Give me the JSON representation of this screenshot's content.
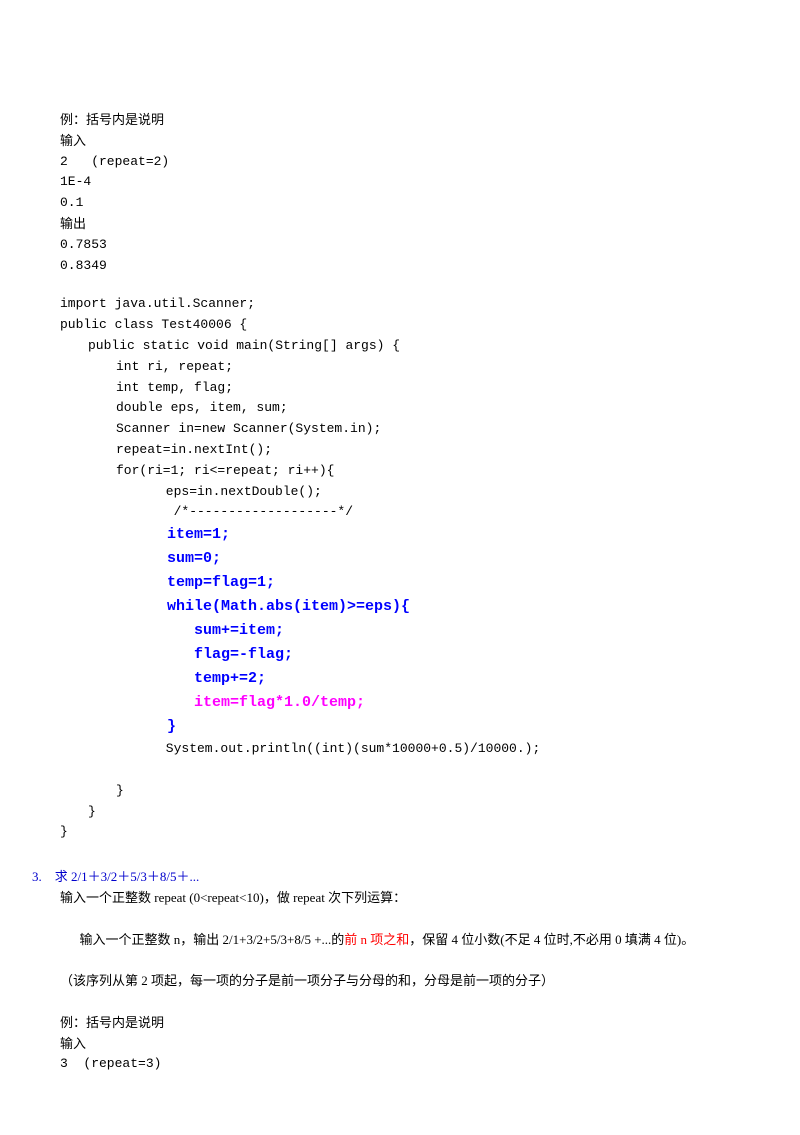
{
  "intro": {
    "l1": "例：括号内是说明",
    "l2": "输入",
    "l3": "2   (repeat=2)",
    "l4": "1E-4",
    "l5": "0.1",
    "l6": "输出",
    "l7": "0.7853",
    "l8": "0.8349"
  },
  "code1": {
    "l1": "import java.util.Scanner;",
    "l2": "public class Test40006 {",
    "l3": "public static void main(String[] args) {",
    "l4": "int ri, repeat;",
    "l5": "int temp, flag;",
    "l6": "double eps, item, sum;",
    "l7": "Scanner in=new Scanner(System.in);",
    "l8": "repeat=in.nextInt();",
    "l9": "for(ri=1; ri<=repeat; ri++){",
    "l10": " eps=in.nextDouble();",
    "l11": "  /*-------------------*/",
    "l12": " item=1;",
    "l13": " sum=0;",
    "l14": " temp=flag=1;",
    "l15": " while(Math.abs(item)>=eps){",
    "l16": "    sum+=item;",
    "l17": "    flag=-flag;",
    "l18": "    temp+=2;",
    "l19": "    item=flag*1.0/temp;",
    "l20": " }",
    "l21": " System.out.println((int)(sum*10000+0.5)/10000.);",
    "l22": "}",
    "l23": "}",
    "l24": "}"
  },
  "section": {
    "num": "3.",
    "title": "求 2/1＋3/2＋5/3＋8/5＋...",
    "p1": "输入一个正整数 repeat (0<repeat<10)，做 repeat 次下列运算：",
    "p2a": "输入一个正整数 n，输出 2/1+3/2+5/3+8/5 +...的",
    "p2red": "前 n 项之和",
    "p2b": "，保留 4 位小数(不足 4 位时,不必用 0 填满 4 位)。",
    "p3": "（该序列从第 2 项起，每一项的分子是前一项分子与分母的和，分母是前一项的分子）",
    "ex1": "例：括号内是说明",
    "ex2": "输入",
    "ex3": "3  (repeat=3)"
  }
}
